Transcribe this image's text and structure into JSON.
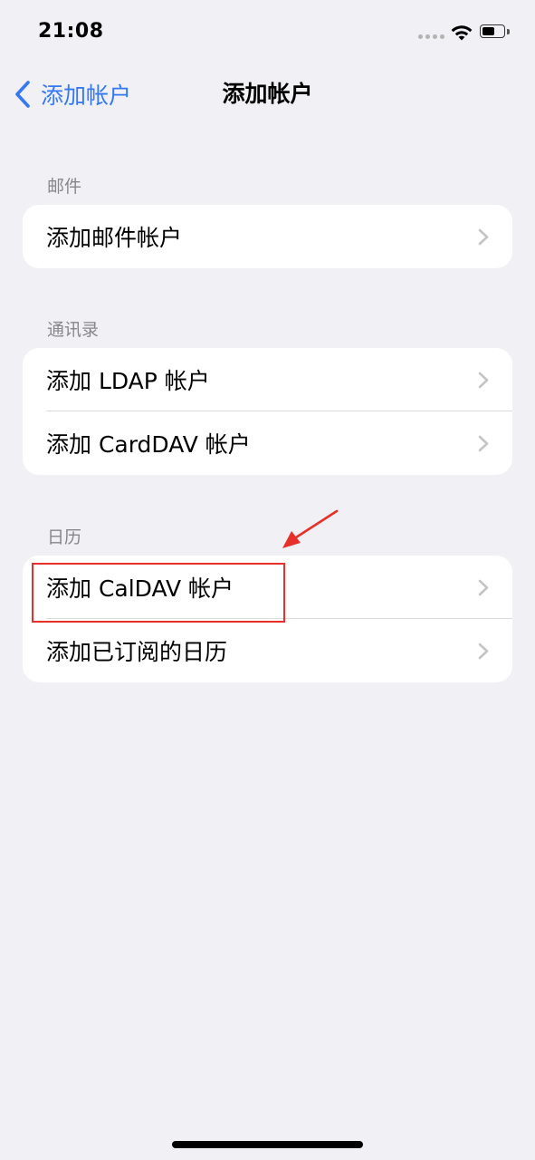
{
  "status_bar": {
    "time": "21:08"
  },
  "nav": {
    "back_label": "添加帐户",
    "title": "添加帐户"
  },
  "sections": [
    {
      "header": "邮件",
      "items": [
        {
          "label": "添加邮件帐户"
        }
      ]
    },
    {
      "header": "通讯录",
      "items": [
        {
          "label": "添加 LDAP 帐户"
        },
        {
          "label": "添加 CardDAV 帐户"
        }
      ]
    },
    {
      "header": "日历",
      "items": [
        {
          "label": "添加 CalDAV 帐户"
        },
        {
          "label": "添加已订阅的日历"
        }
      ]
    }
  ],
  "annotation": {
    "highlight_color": "#e8302a",
    "highlighted_item": "添加 CalDAV 帐户"
  },
  "colors": {
    "accent": "#3478f6",
    "background": "#f0f0f5",
    "group_background": "#ffffff",
    "secondary_text": "#86868b"
  }
}
